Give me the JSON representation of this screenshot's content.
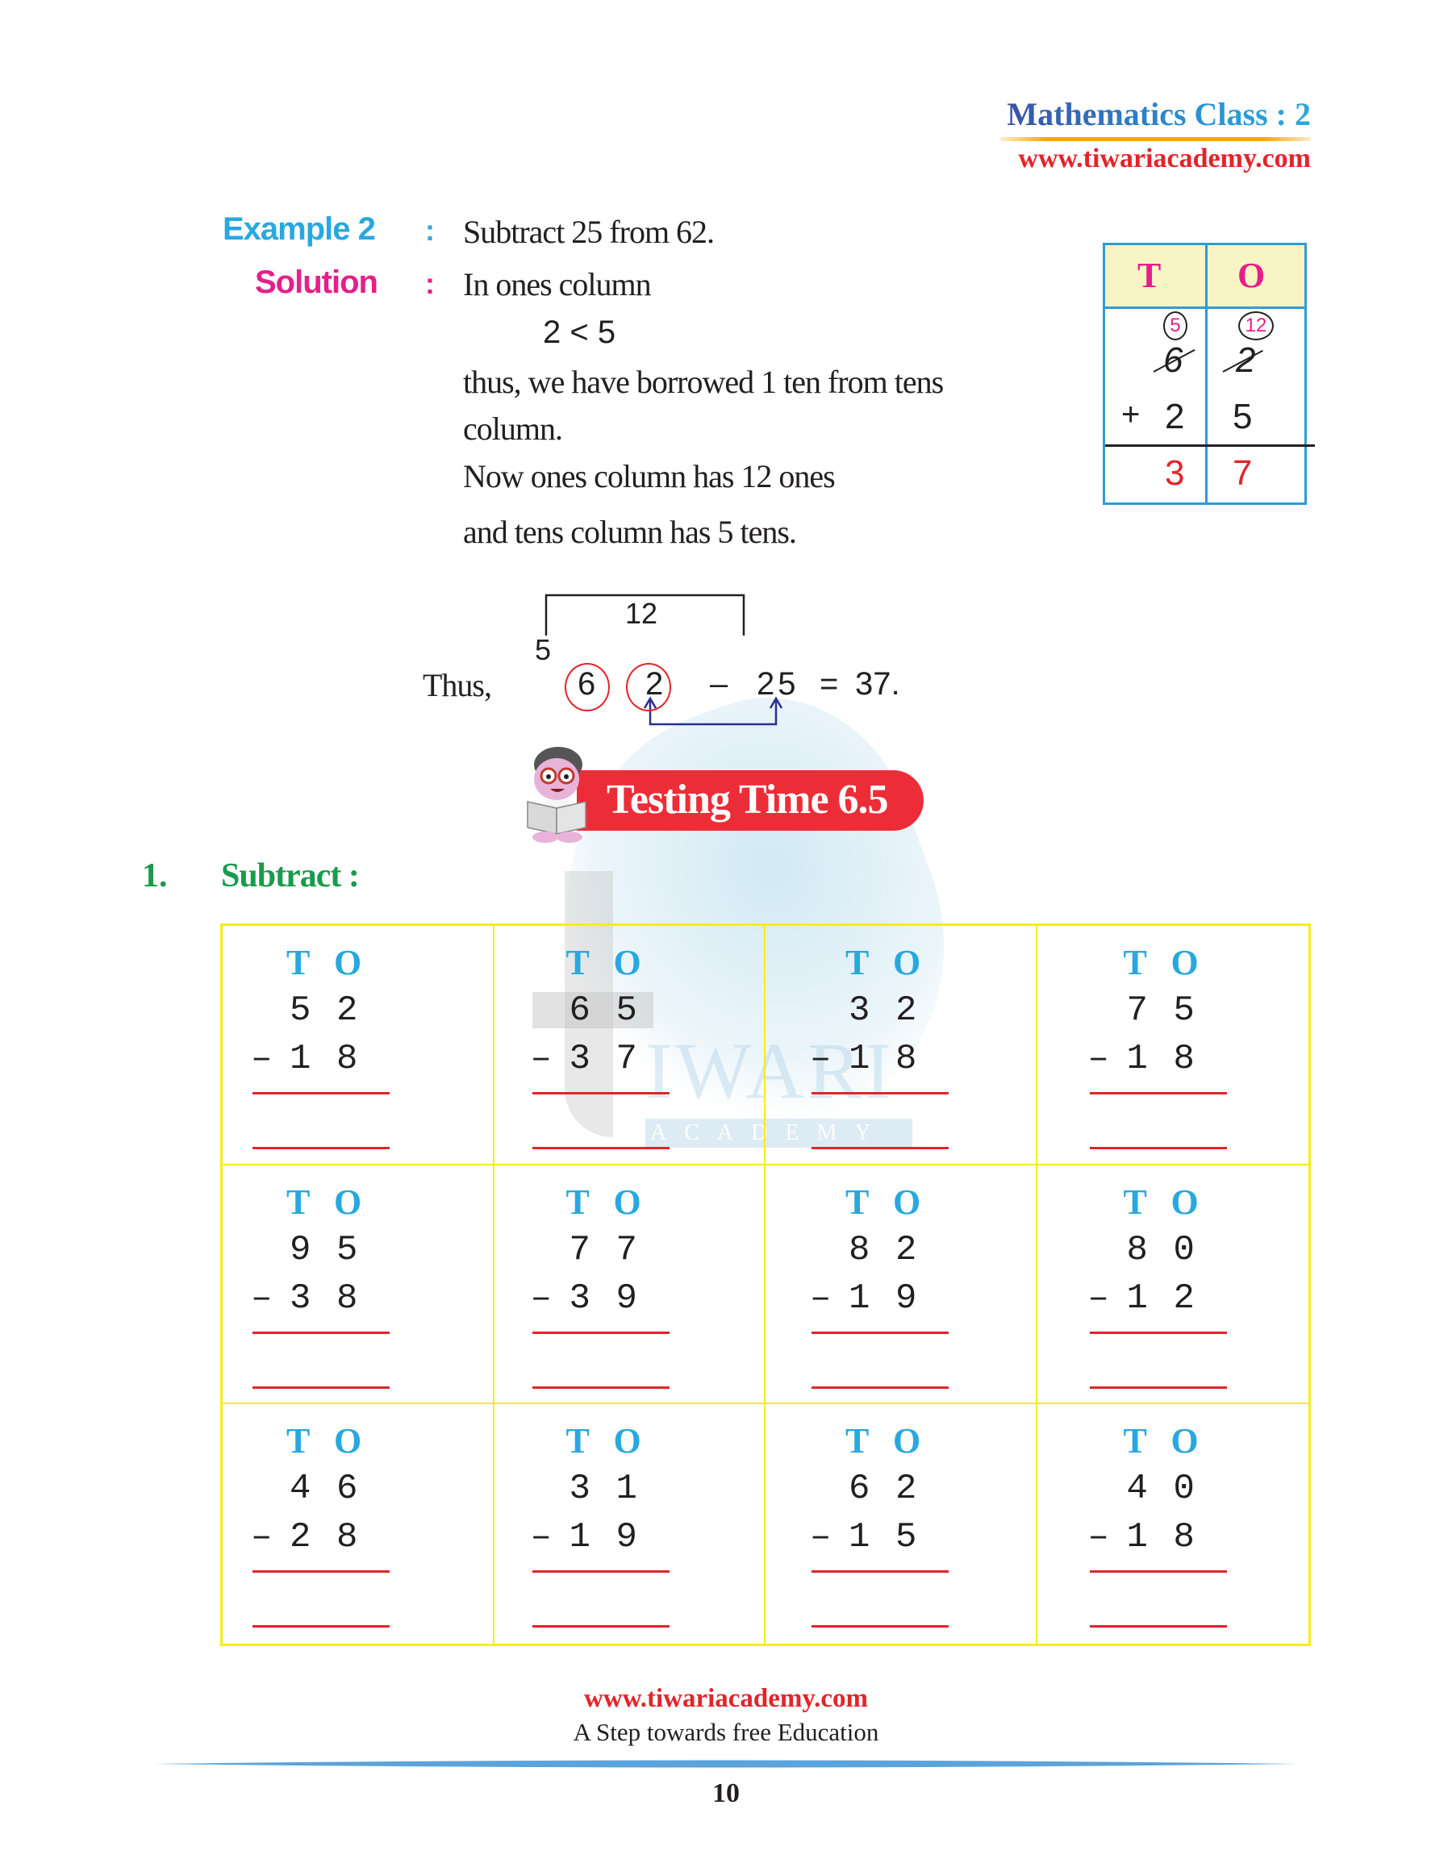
{
  "header": {
    "title": "Mathematics Class : 2",
    "website": "www.tiwariacademy.com"
  },
  "watermark": {
    "letter": "t",
    "text": "IWARI",
    "subtext": "ACADEMY"
  },
  "example": {
    "label": "Example 2",
    "colon": ":",
    "statement": "Subtract 25 from 62.",
    "solution_label": "Solution",
    "solution_lines": [
      "In ones column",
      "2 < 5",
      "thus, we have borrowed 1 ten from tens",
      "column.",
      "Now ones column has 12 ones",
      "and tens column has 5 tens."
    ]
  },
  "place_value_table": {
    "headers": [
      "T",
      "O"
    ],
    "borrowed": {
      "tens": "5",
      "ones": "12"
    },
    "minuend": {
      "tens": "6",
      "ones": "2"
    },
    "operator": "+",
    "subtrahend": {
      "tens": "2",
      "ones": "5"
    },
    "result": {
      "tens": "3",
      "ones": "7"
    }
  },
  "equation": {
    "prefix": "Thus,",
    "bracket_value": "12",
    "borrow_value": "5",
    "minuend_tens": "6",
    "minuend_ones": "2",
    "minus": "–",
    "subtrahend": "25",
    "equals": "=",
    "result": "37."
  },
  "banner": {
    "title": "Testing Time 6.5",
    "mascot": "reading-boy-mascot"
  },
  "exercise": {
    "number": "1.",
    "instruction": "Subtract :",
    "column_labels": [
      "T",
      "O"
    ],
    "operator": "–",
    "problems": [
      {
        "minuend": [
          "5",
          "2"
        ],
        "subtrahend": [
          "1",
          "8"
        ]
      },
      {
        "minuend": [
          "6",
          "5"
        ],
        "subtrahend": [
          "3",
          "7"
        ]
      },
      {
        "minuend": [
          "3",
          "2"
        ],
        "subtrahend": [
          "1",
          "8"
        ]
      },
      {
        "minuend": [
          "7",
          "5"
        ],
        "subtrahend": [
          "1",
          "8"
        ]
      },
      {
        "minuend": [
          "9",
          "5"
        ],
        "subtrahend": [
          "3",
          "8"
        ]
      },
      {
        "minuend": [
          "7",
          "7"
        ],
        "subtrahend": [
          "3",
          "9"
        ]
      },
      {
        "minuend": [
          "8",
          "2"
        ],
        "subtrahend": [
          "1",
          "9"
        ]
      },
      {
        "minuend": [
          "8",
          "0"
        ],
        "subtrahend": [
          "1",
          "2"
        ]
      },
      {
        "minuend": [
          "4",
          "6"
        ],
        "subtrahend": [
          "2",
          "8"
        ]
      },
      {
        "minuend": [
          "3",
          "1"
        ],
        "subtrahend": [
          "1",
          "9"
        ]
      },
      {
        "minuend": [
          "6",
          "2"
        ],
        "subtrahend": [
          "1",
          "5"
        ]
      },
      {
        "minuend": [
          "4",
          "0"
        ],
        "subtrahend": [
          "1",
          "8"
        ]
      }
    ]
  },
  "footer": {
    "website": "www.tiwariacademy.com",
    "tagline": "A Step towards free Education",
    "page_number": "10"
  },
  "colors": {
    "example_label": "#29a8df",
    "solution_label": "#e51f89",
    "exercise_heading": "#1a9a4c",
    "grid_border": "#f7ec1e",
    "answer_line": "#e3242b",
    "banner": "#ec2d37",
    "table_border": "#2f9bd5"
  }
}
